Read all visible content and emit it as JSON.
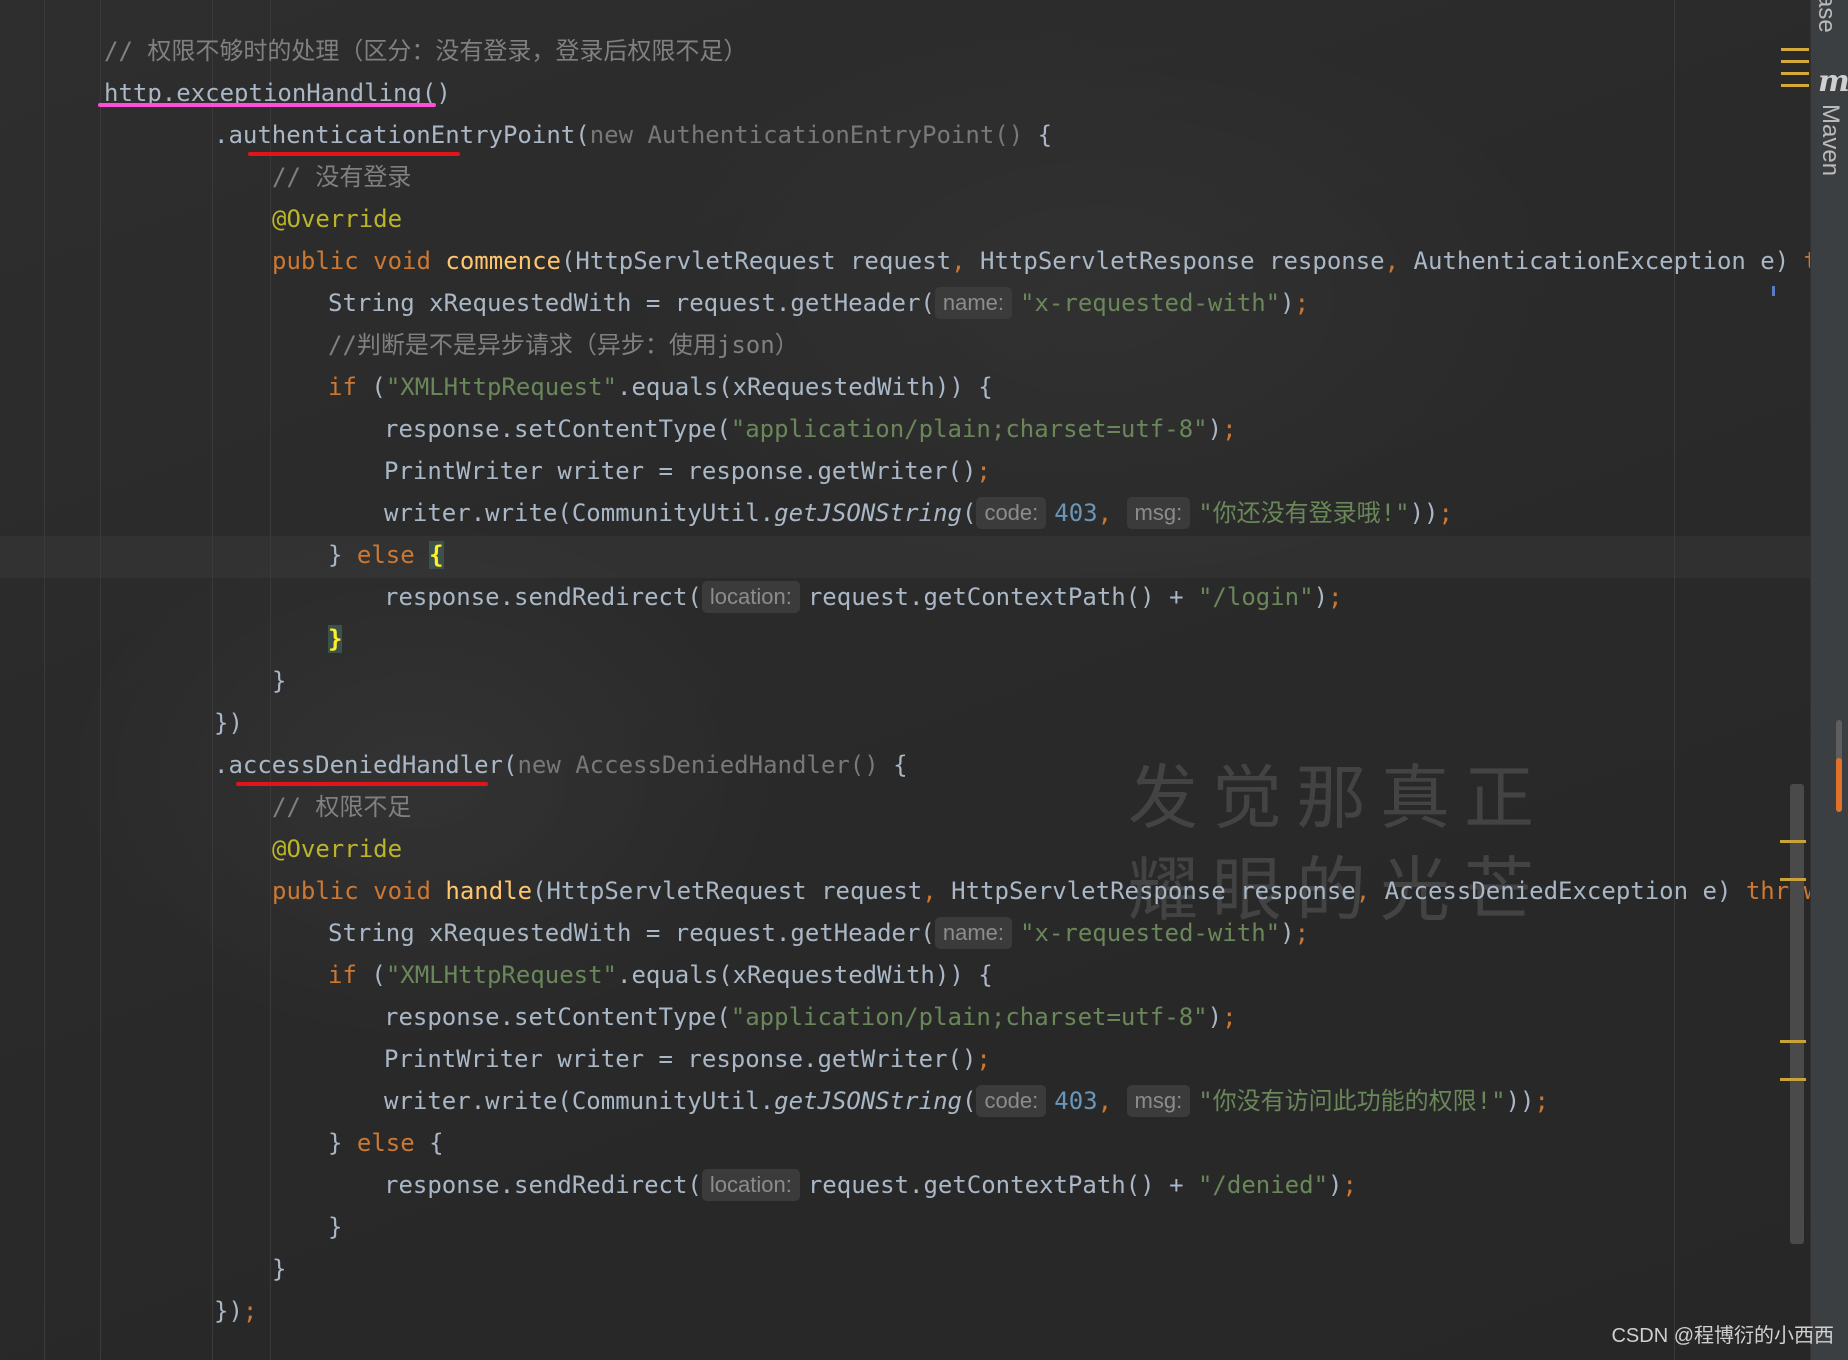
{
  "sidebar": {
    "maven_label": "Maven",
    "top_clipped_label": "ase"
  },
  "lines": [
    {
      "segs": [
        {
          "t": "// 权限不够时的处理（区分：没有登录，登录后权限不足）",
          "c": "cm"
        }
      ]
    },
    {
      "segs": [
        {
          "t": "http.exceptionHandling()",
          "c": ""
        }
      ]
    },
    {
      "segs": [
        {
          "t": ".authenticationEntryPoint(",
          "c": ""
        },
        {
          "t": "new AuthenticationEntryPoint()",
          "c": "gr"
        },
        {
          "t": " {",
          "c": ""
        }
      ]
    },
    {
      "segs": [
        {
          "t": "// 没有登录",
          "c": "cm"
        }
      ]
    },
    {
      "segs": [
        {
          "t": "@Override",
          "c": "an"
        }
      ]
    },
    {
      "segs": [
        {
          "t": "public void ",
          "c": "kw"
        },
        {
          "t": "commence",
          "c": "fn"
        },
        {
          "t": "(HttpServletRequest request",
          "c": ""
        },
        {
          "t": ", ",
          "c": "kw"
        },
        {
          "t": "HttpServletResponse response",
          "c": ""
        },
        {
          "t": ", ",
          "c": "kw"
        },
        {
          "t": "AuthenticationException e) ",
          "c": ""
        },
        {
          "t": "thro",
          "c": "kw"
        }
      ]
    },
    {
      "segs": [
        {
          "t": "String xRequestedWith = request.getHeader(",
          "c": ""
        },
        {
          "t": "name:",
          "c": "hint"
        },
        {
          "t": "\"x-requested-with\"",
          "c": "st"
        },
        {
          "t": ")",
          "c": ""
        },
        {
          "t": ";",
          "c": "kw"
        }
      ]
    },
    {
      "segs": [
        {
          "t": "//判断是不是异步请求（异步：使用json）",
          "c": "cm"
        }
      ]
    },
    {
      "segs": [
        {
          "t": "if ",
          "c": "kw"
        },
        {
          "t": "(",
          "c": ""
        },
        {
          "t": "\"XMLHttpRequest\"",
          "c": "st"
        },
        {
          "t": ".equals(xRequestedWith)) {",
          "c": ""
        }
      ]
    },
    {
      "segs": [
        {
          "t": "response.setContentType(",
          "c": ""
        },
        {
          "t": "\"application/plain;charset=utf-8\"",
          "c": "st"
        },
        {
          "t": ")",
          "c": ""
        },
        {
          "t": ";",
          "c": "kw"
        }
      ]
    },
    {
      "segs": [
        {
          "t": "PrintWriter writer = response.getWriter()",
          "c": ""
        },
        {
          "t": ";",
          "c": "kw"
        }
      ]
    },
    {
      "segs": [
        {
          "t": "writer.write(CommunityUtil.",
          "c": ""
        },
        {
          "t": "getJSONString",
          "c": "it"
        },
        {
          "t": "(",
          "c": ""
        },
        {
          "t": "code:",
          "c": "hint"
        },
        {
          "t": "403",
          "c": "nu"
        },
        {
          "t": ", ",
          "c": "kw"
        },
        {
          "t": "msg:",
          "c": "hint"
        },
        {
          "t": "\"你还没有登录哦!\"",
          "c": "st"
        },
        {
          "t": "))",
          "c": ""
        },
        {
          "t": ";",
          "c": "kw"
        }
      ]
    },
    {
      "segs": [
        {
          "t": "} ",
          "c": ""
        },
        {
          "t": "else ",
          "c": "kw"
        },
        {
          "t": "{",
          "c": "brace-hl"
        }
      ]
    },
    {
      "segs": [
        {
          "t": "response.sendRedirect(",
          "c": ""
        },
        {
          "t": "location:",
          "c": "hint"
        },
        {
          "t": "request.getContextPath() + ",
          "c": ""
        },
        {
          "t": "\"/login\"",
          "c": "st"
        },
        {
          "t": ")",
          "c": ""
        },
        {
          "t": ";",
          "c": "kw"
        }
      ]
    },
    {
      "segs": [
        {
          "t": "}",
          "c": "brace-hl"
        }
      ]
    },
    {
      "segs": [
        {
          "t": "}",
          "c": ""
        }
      ]
    },
    {
      "segs": [
        {
          "t": "})",
          "c": ""
        }
      ]
    },
    {
      "segs": [
        {
          "t": ".accessDeniedHandler(",
          "c": ""
        },
        {
          "t": "new AccessDeniedHandler()",
          "c": "gr"
        },
        {
          "t": " {",
          "c": ""
        }
      ]
    },
    {
      "segs": [
        {
          "t": "// 权限不足",
          "c": "cm"
        }
      ]
    },
    {
      "segs": [
        {
          "t": "@Override",
          "c": "an"
        }
      ]
    },
    {
      "segs": [
        {
          "t": "public void ",
          "c": "kw"
        },
        {
          "t": "handle",
          "c": "fn"
        },
        {
          "t": "(HttpServletRequest request",
          "c": ""
        },
        {
          "t": ", ",
          "c": "kw"
        },
        {
          "t": "HttpServletResponse response",
          "c": ""
        },
        {
          "t": ", ",
          "c": "kw"
        },
        {
          "t": "AccessDeniedException e) ",
          "c": ""
        },
        {
          "t": "throws ",
          "c": "kw"
        },
        {
          "t": "I",
          "c": ""
        }
      ]
    },
    {
      "segs": [
        {
          "t": "String xRequestedWith = request.getHeader(",
          "c": ""
        },
        {
          "t": "name:",
          "c": "hint"
        },
        {
          "t": "\"x-requested-with\"",
          "c": "st"
        },
        {
          "t": ")",
          "c": ""
        },
        {
          "t": ";",
          "c": "kw"
        }
      ]
    },
    {
      "segs": [
        {
          "t": "if ",
          "c": "kw"
        },
        {
          "t": "(",
          "c": ""
        },
        {
          "t": "\"XMLHttpRequest\"",
          "c": "st"
        },
        {
          "t": ".equals(xRequestedWith)) {",
          "c": ""
        }
      ]
    },
    {
      "segs": [
        {
          "t": "response.setContentType(",
          "c": ""
        },
        {
          "t": "\"application/plain;charset=utf-8\"",
          "c": "st"
        },
        {
          "t": ")",
          "c": ""
        },
        {
          "t": ";",
          "c": "kw"
        }
      ]
    },
    {
      "segs": [
        {
          "t": "PrintWriter writer = response.getWriter()",
          "c": ""
        },
        {
          "t": ";",
          "c": "kw"
        }
      ]
    },
    {
      "segs": [
        {
          "t": "writer.write(CommunityUtil.",
          "c": ""
        },
        {
          "t": "getJSONString",
          "c": "it"
        },
        {
          "t": "(",
          "c": ""
        },
        {
          "t": "code:",
          "c": "hint"
        },
        {
          "t": "403",
          "c": "nu"
        },
        {
          "t": ", ",
          "c": "kw"
        },
        {
          "t": "msg:",
          "c": "hint"
        },
        {
          "t": "\"你没有访问此功能的权限!\"",
          "c": "st"
        },
        {
          "t": "))",
          "c": ""
        },
        {
          "t": ";",
          "c": "kw"
        }
      ]
    },
    {
      "segs": [
        {
          "t": "} ",
          "c": ""
        },
        {
          "t": "else ",
          "c": "kw"
        },
        {
          "t": "{",
          "c": ""
        }
      ]
    },
    {
      "segs": [
        {
          "t": "response.sendRedirect(",
          "c": ""
        },
        {
          "t": "location:",
          "c": "hint"
        },
        {
          "t": "request.getContextPath() + ",
          "c": ""
        },
        {
          "t": "\"/denied\"",
          "c": "st"
        },
        {
          "t": ")",
          "c": ""
        },
        {
          "t": ";",
          "c": "kw"
        }
      ]
    },
    {
      "segs": [
        {
          "t": "}",
          "c": ""
        }
      ]
    },
    {
      "segs": [
        {
          "t": "}",
          "c": ""
        }
      ]
    },
    {
      "segs": [
        {
          "t": "})",
          "c": ""
        },
        {
          "t": ";",
          "c": "kw"
        }
      ]
    }
  ],
  "watermark": [
    "发觉那真正",
    "耀眼的光芒"
  ],
  "credit": "CSDN @程博衍的小西西",
  "annotation_colors": {
    "pink": "#ff4fd8",
    "red": "#e0151a"
  }
}
